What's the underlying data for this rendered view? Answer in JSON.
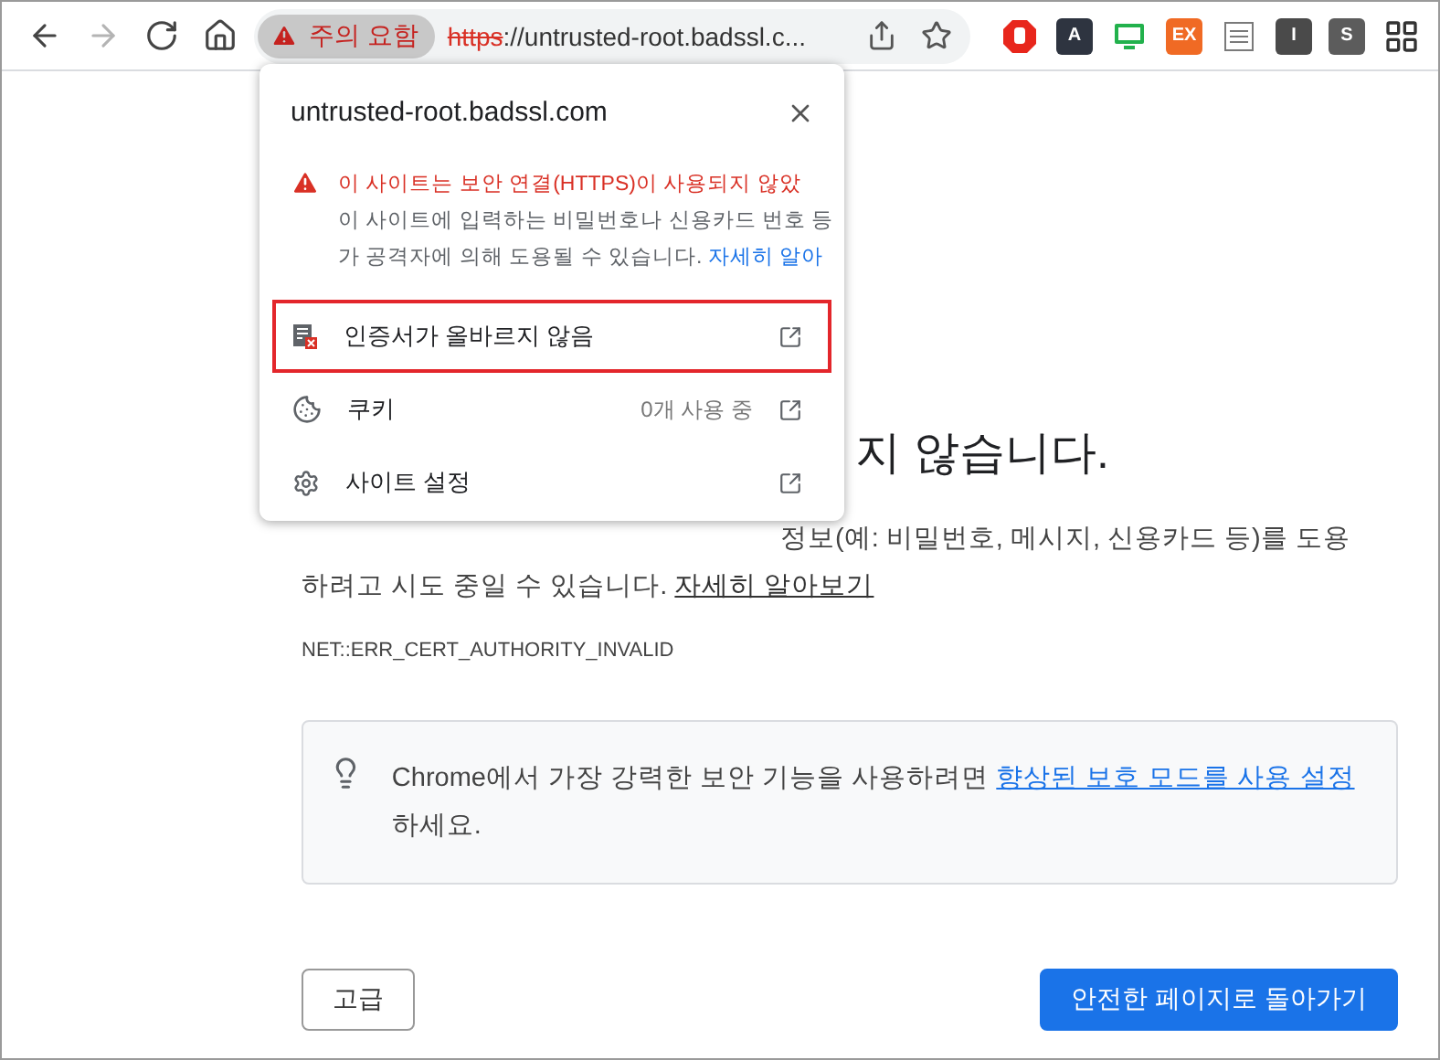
{
  "toolbar": {
    "nav_buttons": [
      {
        "kind": "back",
        "disabled": false
      },
      {
        "kind": "forward",
        "disabled": true
      },
      {
        "kind": "reload",
        "disabled": false
      },
      {
        "kind": "home",
        "disabled": false
      }
    ],
    "security_chip": {
      "label": "주의 요함"
    },
    "address": {
      "scheme": "https",
      "rest": "://untrusted-root.badssl.c..."
    },
    "extensions": [
      {
        "kind": "stop",
        "color": "#e8261c"
      },
      {
        "kind": "letter",
        "label": "A",
        "color": "#2e3440"
      },
      {
        "kind": "screen",
        "color": "#22b14c"
      },
      {
        "kind": "letter",
        "label": "EX",
        "color": "#f06a24"
      },
      {
        "kind": "list",
        "color": "#7a7a7a"
      },
      {
        "kind": "letter",
        "label": "I",
        "color": "#4a4a4a"
      },
      {
        "kind": "letter",
        "label": "S",
        "color": "#5c5c5c"
      },
      {
        "kind": "grid",
        "color": "#333333"
      }
    ]
  },
  "site_info_popup": {
    "host": "untrusted-root.badssl.com",
    "warning_lines": [
      "이 사이트는 보안 연결(HTTPS)이 사용되지 않았",
      "이 사이트에 입력하는 비밀번호나 신용카드 번호 등",
      "가 공격자에 의해 도용될 수 있습니다."
    ],
    "learn_more": "자세히 알아",
    "rows": [
      {
        "kind": "certificate",
        "label": "인증서가 올바르지 않음",
        "selected": true
      },
      {
        "kind": "cookies",
        "label": "쿠키",
        "detail": "0개 사용 중",
        "selected": false
      },
      {
        "kind": "settings",
        "label": "사이트 설정",
        "selected": false
      }
    ]
  },
  "page": {
    "heading": "지 않습니다.",
    "paragraph_line": "정보(예: 비밀번호, 메시지, 신용카드 등)를 도용",
    "paragraph_rest": "하려고 시도 중일 수 있습니다.",
    "learn_more": "자세히 알아보기",
    "error_code": "NET::ERR_CERT_AUTHORITY_INVALID",
    "tip": {
      "text": "Chrome에서 가장 강력한 보안 기능을 사용하려면",
      "link": "향상된 보호 모드를 사용 설정",
      "after": "하세요."
    },
    "buttons": [
      {
        "kind": "secondary",
        "label": "고급"
      },
      {
        "kind": "primary",
        "label": "안전한 페이지로 돌아가기"
      }
    ]
  }
}
